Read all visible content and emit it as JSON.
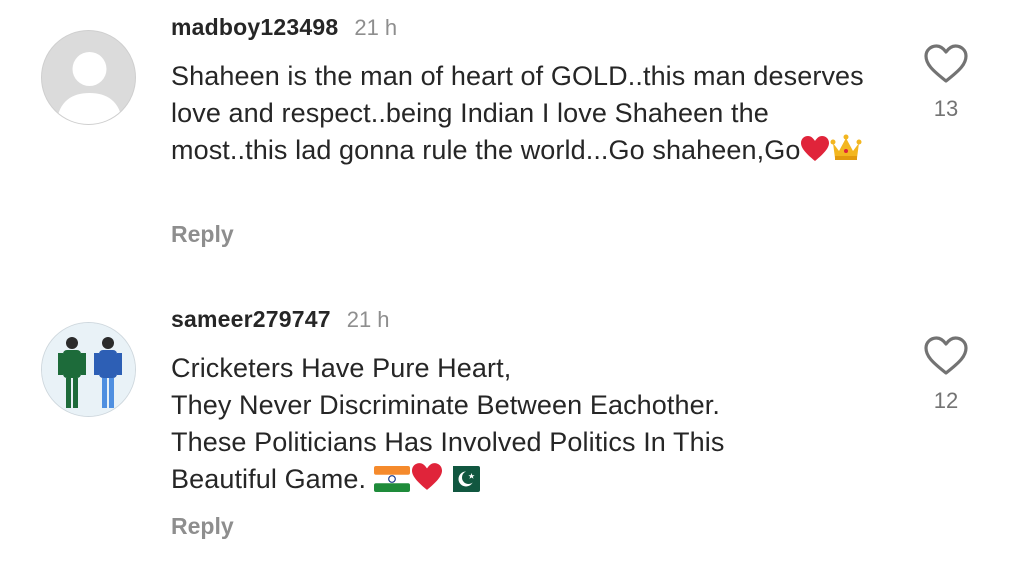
{
  "comments": [
    {
      "username": "madboy123498",
      "time": "21 h",
      "text_before_emoji": "Shaheen is the man of heart of GOLD..this man deserves love and respect..being Indian I love Shaheen the most..this lad gonna rule the world...Go shaheen,Go",
      "emojis": [
        "red-heart-emoji",
        "crown-emoji"
      ],
      "reply_label": "Reply",
      "like_count": "13",
      "avatar": "default-avatar"
    },
    {
      "username": "sameer279747",
      "time": "21 h",
      "text_lines": [
        "Cricketers Have Pure Heart,",
        "They Never Discriminate Between Eachother.",
        "These Politicians Has Involved Politics In This",
        "Beautiful Game."
      ],
      "emojis": [
        "india-flag-emoji",
        "red-heart-emoji",
        "pakistan-flag-emoji"
      ],
      "reply_label": "Reply",
      "like_count": "12",
      "avatar": "two-cricketers-photo"
    }
  ],
  "colors": {
    "username": "#262626",
    "secondary": "#8e8e8e",
    "heart_emoji": "#e0243a"
  }
}
